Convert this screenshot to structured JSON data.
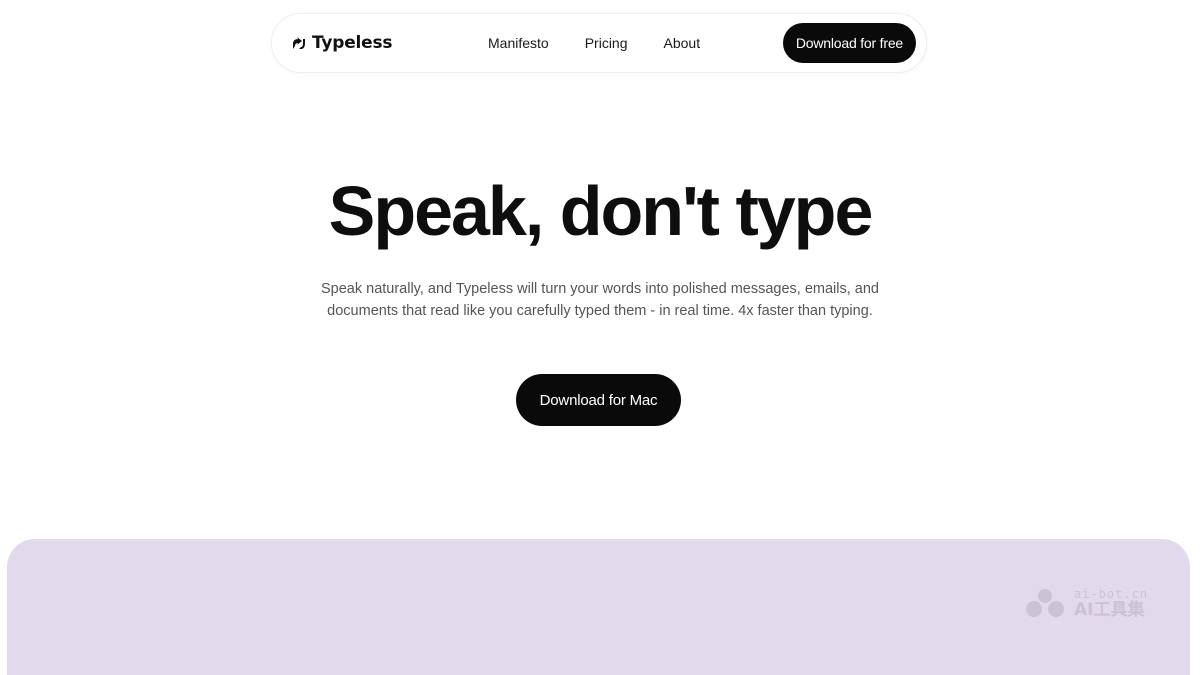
{
  "brand": {
    "name": "Typeless",
    "icon": "typeless-logo-icon"
  },
  "nav": {
    "links": [
      {
        "label": "Manifesto"
      },
      {
        "label": "Pricing"
      },
      {
        "label": "About"
      }
    ],
    "cta_label": "Download for free"
  },
  "hero": {
    "title": "Speak, don't type",
    "subtitle_line1": "Speak naturally, and Typeless will turn your words into polished messages, emails, and",
    "subtitle_line2": "documents that read like you carefully typed them - in real time. 4x faster than typing.",
    "cta_label": "Download for Mac"
  },
  "watermark": {
    "top": "ai-bot.cn",
    "bottom": "AI工具集"
  },
  "colors": {
    "primary": "#0a0a0a",
    "panel": "#e3d9ec",
    "subtitle": "#555555"
  }
}
